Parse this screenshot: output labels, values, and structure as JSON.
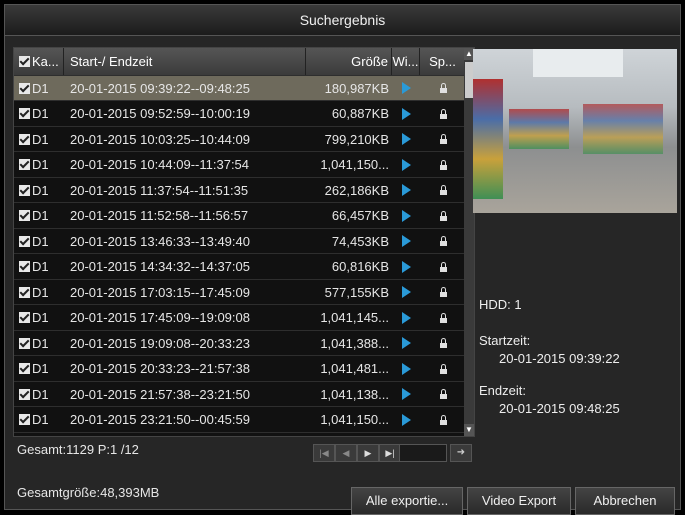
{
  "window": {
    "title": "Suchergebnis"
  },
  "table": {
    "headers": {
      "channel": "Ka...",
      "time": "Start-/ Endzeit",
      "size": "Größe",
      "play": "Wi...",
      "lock": "Sp..."
    },
    "rows": [
      {
        "channel": "D1",
        "time": "20-01-2015 09:39:22--09:48:25",
        "size": "180,987KB",
        "selected": true
      },
      {
        "channel": "D1",
        "time": "20-01-2015 09:52:59--10:00:19",
        "size": "60,887KB"
      },
      {
        "channel": "D1",
        "time": "20-01-2015 10:03:25--10:44:09",
        "size": "799,210KB"
      },
      {
        "channel": "D1",
        "time": "20-01-2015 10:44:09--11:37:54",
        "size": "1,041,150..."
      },
      {
        "channel": "D1",
        "time": "20-01-2015 11:37:54--11:51:35",
        "size": "262,186KB"
      },
      {
        "channel": "D1",
        "time": "20-01-2015 11:52:58--11:56:57",
        "size": "66,457KB"
      },
      {
        "channel": "D1",
        "time": "20-01-2015 13:46:33--13:49:40",
        "size": "74,453KB"
      },
      {
        "channel": "D1",
        "time": "20-01-2015 14:34:32--14:37:05",
        "size": "60,816KB"
      },
      {
        "channel": "D1",
        "time": "20-01-2015 17:03:15--17:45:09",
        "size": "577,155KB"
      },
      {
        "channel": "D1",
        "time": "20-01-2015 17:45:09--19:09:08",
        "size": "1,041,145..."
      },
      {
        "channel": "D1",
        "time": "20-01-2015 19:09:08--20:33:23",
        "size": "1,041,388..."
      },
      {
        "channel": "D1",
        "time": "20-01-2015 20:33:23--21:57:38",
        "size": "1,041,481..."
      },
      {
        "channel": "D1",
        "time": "20-01-2015 21:57:38--23:21:50",
        "size": "1,041,138..."
      },
      {
        "channel": "D1",
        "time": "20-01-2015 23:21:50--00:45:59",
        "size": "1,041,150..."
      }
    ]
  },
  "pager": {
    "summary": "Gesamt:1129 P:1 /12"
  },
  "info": {
    "hdd": "HDD: 1",
    "start_label": "Startzeit:",
    "start_value": "20-01-2015 09:39:22",
    "end_label": "Endzeit:",
    "end_value": "20-01-2015 09:48:25"
  },
  "footer": {
    "total_size": "Gesamtgröße:48,393MB",
    "export_all": "Alle exportie...",
    "video_export": "Video Export",
    "cancel": "Abbrechen"
  },
  "colors": {
    "selected_row": "#6e6a5c",
    "play_icon": "#2a9ad8"
  },
  "icons": {
    "play": "play-icon",
    "lock": "lock-icon",
    "checkbox": "checkbox-checked-icon"
  }
}
